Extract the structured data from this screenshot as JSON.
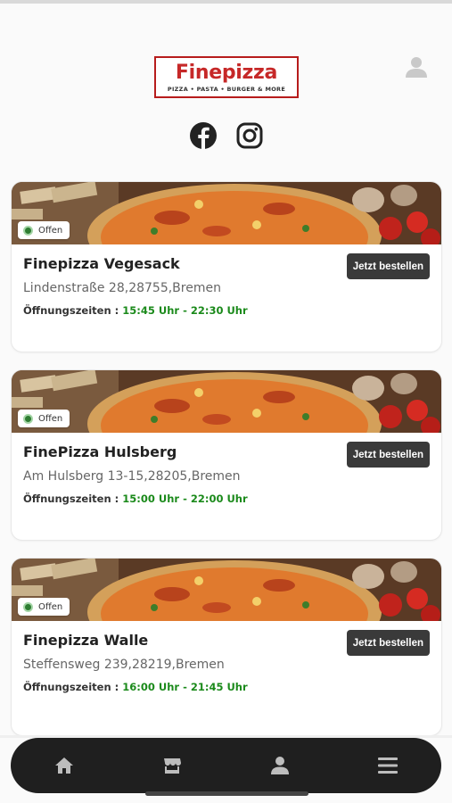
{
  "brand": {
    "name": "Finepizza",
    "tagline": "PIZZA • PASTA • BURGER & MORE",
    "primary_color": "#c62828"
  },
  "header": {
    "profile_icon": "user-icon",
    "social": [
      "facebook-icon",
      "instagram-icon"
    ]
  },
  "restaurants": [
    {
      "name": "Finepizza Vegesack",
      "address": "Lindenstraße 28,28755,Bremen",
      "hours_label": "Öffnungszeiten : ",
      "hours": "15:45 Uhr - 22:30 Uhr",
      "status": "Offen",
      "order_label": "Jetzt bestellen"
    },
    {
      "name": "FinePizza Hulsberg",
      "address": "Am Hulsberg 13-15,28205,Bremen",
      "hours_label": "Öffnungszeiten : ",
      "hours": "15:00 Uhr - 22:00 Uhr",
      "status": "Offen",
      "order_label": "Jetzt bestellen"
    },
    {
      "name": "Finepizza Walle",
      "address": "Steffensweg 239,28219,Bremen",
      "hours_label": "Öffnungszeiten : ",
      "hours": "16:00 Uhr - 21:45 Uhr",
      "status": "Offen",
      "order_label": "Jetzt bestellen"
    }
  ],
  "bottom_nav": [
    "home-icon",
    "store-icon",
    "account-icon",
    "menu-icon"
  ],
  "colors": {
    "open_green": "#2e7d32",
    "hours_green": "#1b8a1b",
    "button_dark": "#3a3a3a",
    "nav_dark": "#1f1f1f"
  }
}
